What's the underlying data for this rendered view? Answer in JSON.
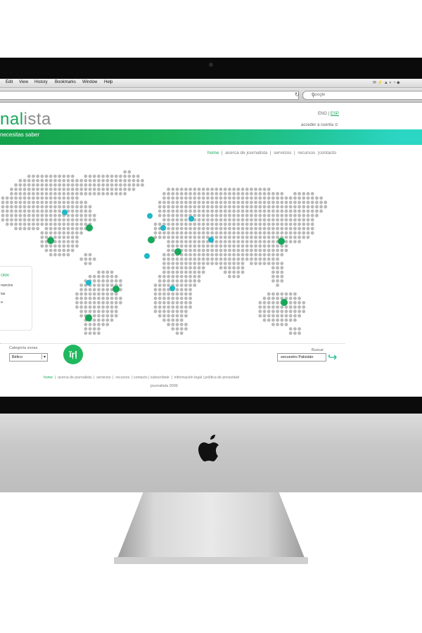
{
  "browser": {
    "menus": [
      "Edit",
      "View",
      "History",
      "Bookmarks",
      "Window",
      "Help"
    ],
    "search_placeholder": "Google"
  },
  "site": {
    "logo_main": "na",
    "logo_highlight": "l",
    "logo_tail": "ista",
    "lang_eng": "ENG",
    "lang_sep": "|",
    "lang_esp": "ESP",
    "login": "acceder a cuenta",
    "tagline": "necesitas saber",
    "nav": [
      "home",
      "acerca de journalista",
      "servicios",
      "recursos",
      "contacto"
    ],
    "sidebox": {
      "heading": "ORA!",
      "items": [
        "nuncios",
        "ias",
        "a"
      ]
    },
    "category_label": "Categoría zonas",
    "category_value": "Bélico",
    "search_label": "Buscar",
    "search_value": "secuestro Pakistán",
    "footer_nav": [
      "home",
      "acerca de journalista",
      "servicios",
      "recursos",
      "contacto",
      "subscríbete",
      "información legal",
      "política de privacidad"
    ],
    "copyright": "journalista 2009"
  },
  "colors": {
    "brand_green": "#19a85a",
    "brand_teal": "#1fb8c8",
    "map_dot": "#b9b9b9"
  },
  "icons": {
    "badge_glyph": "ĭŗļ",
    "go_icon": "↪",
    "apple_logo": "apple-logo",
    "camera": "camera-icon"
  }
}
